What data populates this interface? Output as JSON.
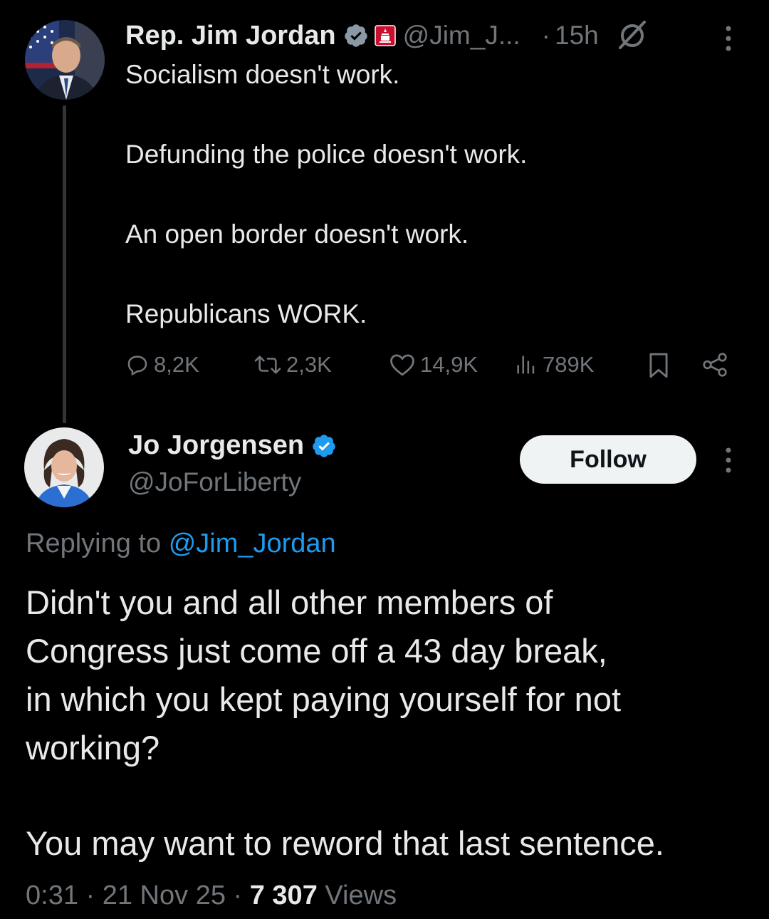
{
  "parent_tweet": {
    "author_name": "Rep. Jim Jordan",
    "handle": "@Jim_J...",
    "separator": "·",
    "time": "15h",
    "lines": [
      "Socialism doesn't work.",
      "Defunding the police doesn't work.",
      "An open border doesn't work.",
      "Republicans WORK."
    ],
    "replies": "8,2K",
    "reposts": "2,3K",
    "likes": "14,9K",
    "views": "789K"
  },
  "reply_tweet": {
    "author_name": "Jo Jorgensen",
    "handle": "@JoForLiberty",
    "follow_label": "Follow",
    "replying_prefix": "Replying to",
    "replying_mention": "@Jim_Jordan",
    "lines": [
      "Didn't you and all other members of",
      "Congress just come off a 43 day break,",
      "in which you kept paying yourself for not",
      "working?",
      "You may want to reword that last sentence."
    ],
    "timestamp": "0:31 · 21 Nov 25 · ",
    "view_count": "7 307",
    "view_label": " Views"
  },
  "colors": {
    "background": "#000000",
    "text": "#e7e9ea",
    "secondary": "#71767b",
    "accent": "#1d9bf0",
    "verified": "#1d9bf0"
  },
  "icons": [
    "verified-badge-icon",
    "government-badge-icon",
    "grok-icon",
    "more-icon",
    "reply-icon",
    "repost-icon",
    "like-icon",
    "views-icon",
    "bookmark-icon",
    "share-icon"
  ]
}
